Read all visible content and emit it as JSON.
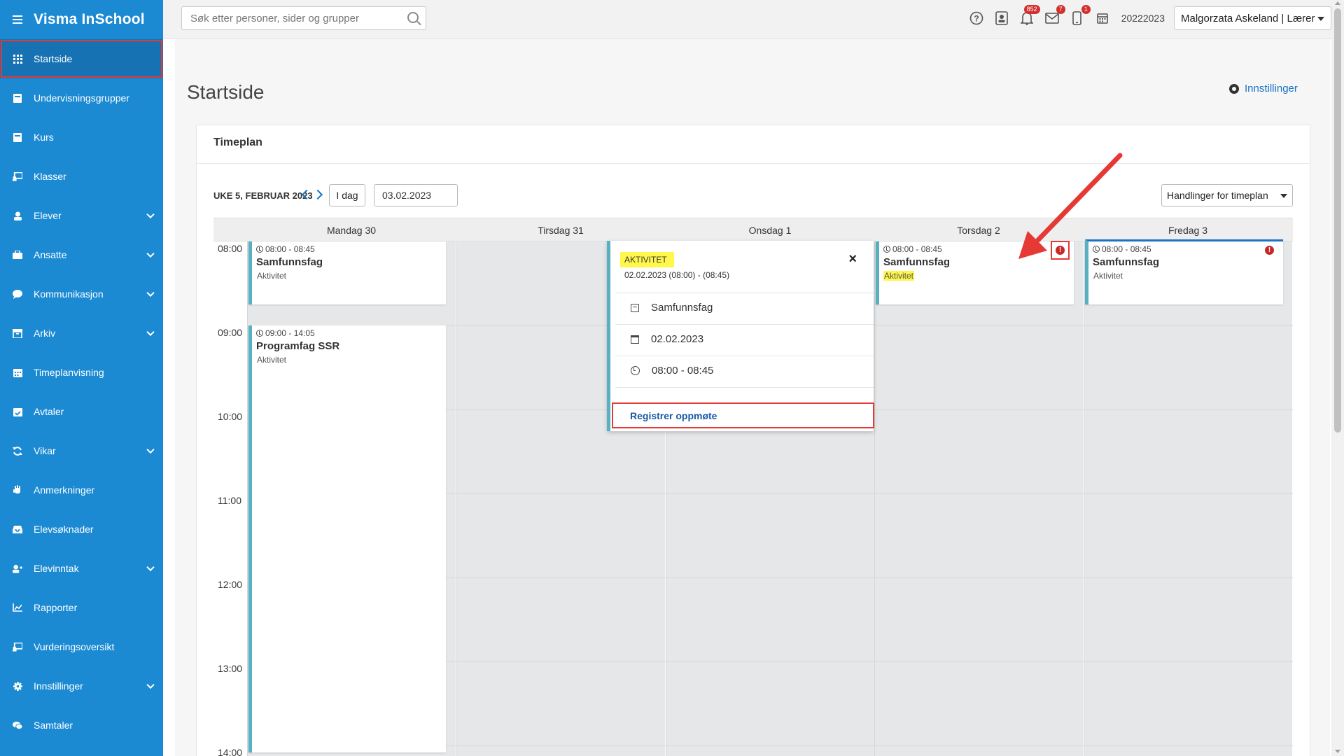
{
  "app": {
    "title": "Visma InSchool"
  },
  "sidebar": {
    "items": [
      {
        "label": "Startside",
        "icon": "grid-icon",
        "active": true,
        "expandable": false
      },
      {
        "label": "Undervisningsgrupper",
        "icon": "book-icon",
        "expandable": false
      },
      {
        "label": "Kurs",
        "icon": "book-icon",
        "expandable": false
      },
      {
        "label": "Klasser",
        "icon": "board-icon",
        "expandable": false
      },
      {
        "label": "Elever",
        "icon": "student-icon",
        "expandable": true
      },
      {
        "label": "Ansatte",
        "icon": "briefcase-icon",
        "expandable": true
      },
      {
        "label": "Kommunikasjon",
        "icon": "chat-icon",
        "expandable": true
      },
      {
        "label": "Arkiv",
        "icon": "archive-icon",
        "expandable": true
      },
      {
        "label": "Timeplanvisning",
        "icon": "calendar-icon",
        "expandable": false
      },
      {
        "label": "Avtaler",
        "icon": "calendar-check-icon",
        "expandable": false
      },
      {
        "label": "Vikar",
        "icon": "refresh-icon",
        "expandable": true
      },
      {
        "label": "Anmerkninger",
        "icon": "hand-icon",
        "expandable": false
      },
      {
        "label": "Elevsøknader",
        "icon": "inbox-icon",
        "expandable": false
      },
      {
        "label": "Elevinntak",
        "icon": "user-plus-icon",
        "expandable": true
      },
      {
        "label": "Rapporter",
        "icon": "chart-icon",
        "expandable": false
      },
      {
        "label": "Vurderingsoversikt",
        "icon": "board-icon",
        "expandable": false
      },
      {
        "label": "Innstillinger",
        "icon": "gear-icon",
        "expandable": true
      },
      {
        "label": "Samtaler",
        "icon": "chat-icon",
        "expandable": false
      }
    ]
  },
  "topbar": {
    "search_placeholder": "Søk etter personer, sider og grupper",
    "notifications_badge": "852",
    "messages_badge": "7",
    "mobile_badge": "1",
    "term": "20222023",
    "user": "Malgorzata Askeland | Lærer"
  },
  "page": {
    "title": "Startside",
    "settings_label": "Innstillinger"
  },
  "timeplan": {
    "title": "Timeplan",
    "week_label": "UKE 5, FEBRUAR 2023",
    "today_label": "I dag",
    "date_value": "03.02.2023",
    "actions_label": "Handlinger for timeplan",
    "days": [
      "Mandag 30",
      "Tirsdag 31",
      "Onsdag 1",
      "Torsdag 2",
      "Fredag 3"
    ],
    "hours": [
      "08:00",
      "09:00",
      "10:00",
      "11:00",
      "12:00",
      "13:00",
      "14:00"
    ],
    "events": {
      "mon1": {
        "time": "08:00 - 08:45",
        "title": "Samfunnsfag",
        "sub": "Aktivitet"
      },
      "mon2": {
        "time": "09:00 - 14:05",
        "title": "Programfag SSR",
        "sub": "Aktivitet"
      },
      "thu1": {
        "time": "08:00 - 08:45",
        "title": "Samfunnsfag",
        "sub": "Aktivitet"
      },
      "fri1": {
        "time": "08:00 - 08:45",
        "title": "Samfunnsfag",
        "sub": "Aktivitet"
      }
    },
    "popup": {
      "label": "AKTIVITET",
      "datetime": "02.02.2023 (08:00) - (08:45)",
      "close": "×",
      "subject": "Samfunnsfag",
      "date": "02.02.2023",
      "time": "08:00 - 08:45",
      "register_label": "Registrer oppmøte"
    }
  },
  "colors": {
    "sidebar": "#1b8ad3",
    "event_accent": "#57b1c2",
    "highlight": "#fff74a",
    "annotation": "#e53935",
    "warning": "#c62828"
  }
}
